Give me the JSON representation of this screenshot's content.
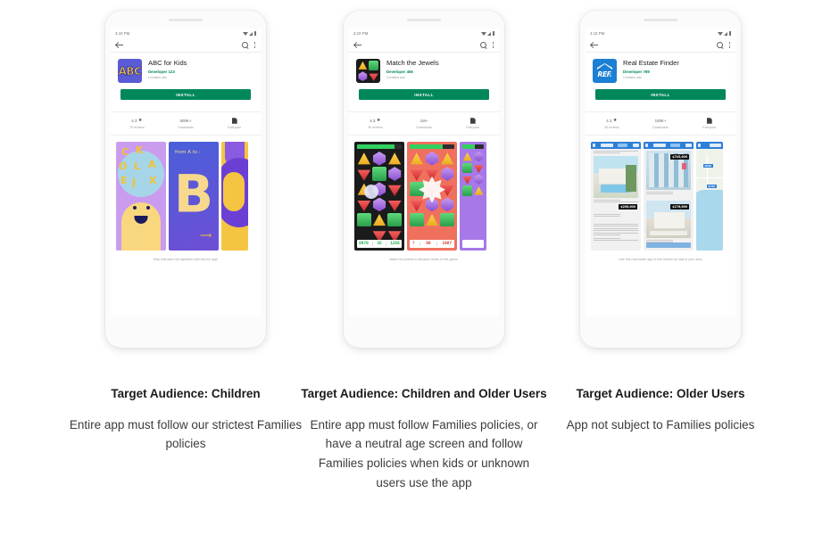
{
  "columns": [
    {
      "phone": {
        "status": {
          "time": "4:10 PM"
        },
        "app": {
          "title": "ABC for Kids",
          "developer": "Developer 123",
          "ads_note": "Contains ads",
          "icon_text": "ABC",
          "install_label": "INSTALL"
        },
        "stats": {
          "rating_value": "4.3",
          "rating_sub": "78 reviews",
          "downloads_value": "500K+",
          "downloads_sub": "Downloads",
          "content_value": "",
          "content_sub": "Everyone"
        },
        "screenshot_caption": "Help kids learn the alphabet with this fun app!",
        "art": {
          "panel2_top": "from A to :",
          "panel2_letter": "B",
          "scattered_letters": [
            "C",
            "K",
            "O",
            "L",
            "A",
            "E",
            "J",
            "X"
          ]
        }
      },
      "caption": {
        "title": "Target Audience: Children",
        "body": "Entire app must follow our strictest Families policies"
      }
    },
    {
      "phone": {
        "status": {
          "time": "4:10 PM"
        },
        "app": {
          "title": "Match the Jewels",
          "developer": "Developer 456",
          "ads_note": "Contains ads",
          "icon_text": "",
          "install_label": "INSTALL"
        },
        "stats": {
          "rating_value": "4.3",
          "rating_sub": "36 reviews",
          "downloads_value": "1M+",
          "downloads_sub": "Downloads",
          "content_value": "",
          "content_sub": "Everyone"
        },
        "screenshot_caption": "Match the jewels to advance levels  in this game.",
        "art": {
          "panel1_scores": [
            "6970",
            "35",
            "1256"
          ],
          "panel2_scores": [
            "?",
            "66",
            "1987"
          ]
        }
      },
      "caption": {
        "title": "Target Audience: Children and Older Users",
        "body": "Entire app must follow Families policies, or have a neutral age screen and follow Families policies when kids or unknown users use the app"
      }
    },
    {
      "phone": {
        "status": {
          "time": "4:10 PM"
        },
        "app": {
          "title": "Real Estate Finder",
          "developer": "Developer 789",
          "ads_note": "Contains ads",
          "icon_text": "REF.",
          "install_label": "INSTALL"
        },
        "stats": {
          "rating_value": "4.3",
          "rating_sub": "36 reviews",
          "downloads_value": "100K+",
          "downloads_sub": "Downloads",
          "content_value": "",
          "content_sub": "Everyone"
        },
        "screenshot_caption": "Use this real estate app to find homes for sale in your area",
        "art": {
          "price1": "$200,000",
          "price2": "$745,000",
          "price3": "$176,000",
          "map_markers": [
            "$200K",
            "$745K"
          ]
        }
      },
      "caption": {
        "title": "Target Audience: Older Users",
        "body": "App not subject to Families policies"
      }
    }
  ],
  "colors": {
    "install_green": "#00875a",
    "developer_green": "#01875f",
    "brand_blue": "#2f7fd6"
  }
}
